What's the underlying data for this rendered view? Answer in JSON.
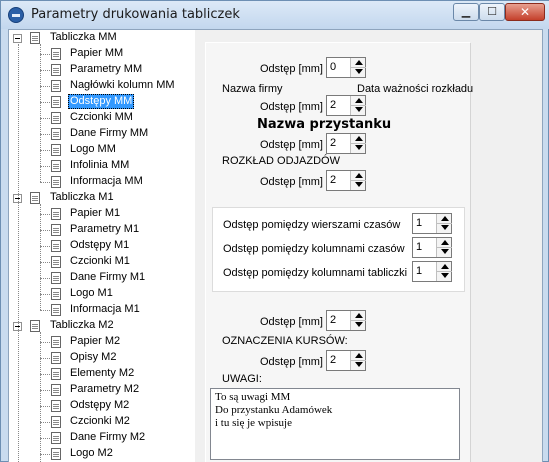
{
  "window": {
    "title": "Parametry drukowania tabliczek"
  },
  "tree": {
    "groups": [
      {
        "label": "Tabliczka MM",
        "children": [
          "Papier MM",
          "Parametry MM",
          "Nagłówki kolumn MM",
          "Odstępy MM",
          "Czcionki MM",
          "Dane Firmy MM",
          "Logo MM",
          "Infolinia MM",
          "Informacja MM"
        ]
      },
      {
        "label": "Tabliczka M1",
        "children": [
          "Papier M1",
          "Parametry M1",
          "Odstępy M1",
          "Czcionki M1",
          "Dane Firmy M1",
          "Logo M1",
          "Informacja M1"
        ]
      },
      {
        "label": "Tabliczka M2",
        "children": [
          "Papier M2",
          "Opisy M2",
          "Elementy M2",
          "Parametry M2",
          "Odstępy M2",
          "Czcionki M2",
          "Dane Firmy M2",
          "Logo M2"
        ]
      }
    ],
    "selected": "Odstępy MM"
  },
  "form": {
    "odstep_label": "Odstęp [mm]",
    "odstep1": "0",
    "nazwa_firmy": "Nazwa firmy",
    "data_waznosci": "Data ważności rozkładu",
    "odstep2": "2",
    "nazwa_przystanku": "Nazwa przystanku",
    "odstep3": "2",
    "rozklad_odjazdow": "ROZKŁAD ODJAZDÓW",
    "odstep4": "2",
    "wiersze_label": "Odstęp pomiędzy wierszami  czasów",
    "wiersze_val": "1",
    "kolumny_czasow_label": "Odstęp pomiędzy kolumnami czasów",
    "kolumny_czasow_val": "1",
    "kolumny_tabliczki_label": "Odstęp pomiędzy kolumnami tabliczki",
    "kolumny_tabliczki_val": "1",
    "odstep5": "2",
    "oznaczenia_kursow": "OZNACZENIA  KURSÓW:",
    "odstep6": "2",
    "uwagi_label": "UWAGI:",
    "uwagi_lines": [
      "To są uwagi MM",
      "Do przystanku Adamówek",
      "i tu się je wpisuje"
    ]
  },
  "icons": {
    "app": "app-logo-icon",
    "tree_node": "document-icon",
    "expander": "collapse-icon",
    "spin_up": "arrow-up-icon",
    "spin_down": "arrow-down-icon"
  },
  "colors": {
    "selection": "#3399ff",
    "titlebar": "#c9dbef",
    "close_button": "#c4402b"
  }
}
